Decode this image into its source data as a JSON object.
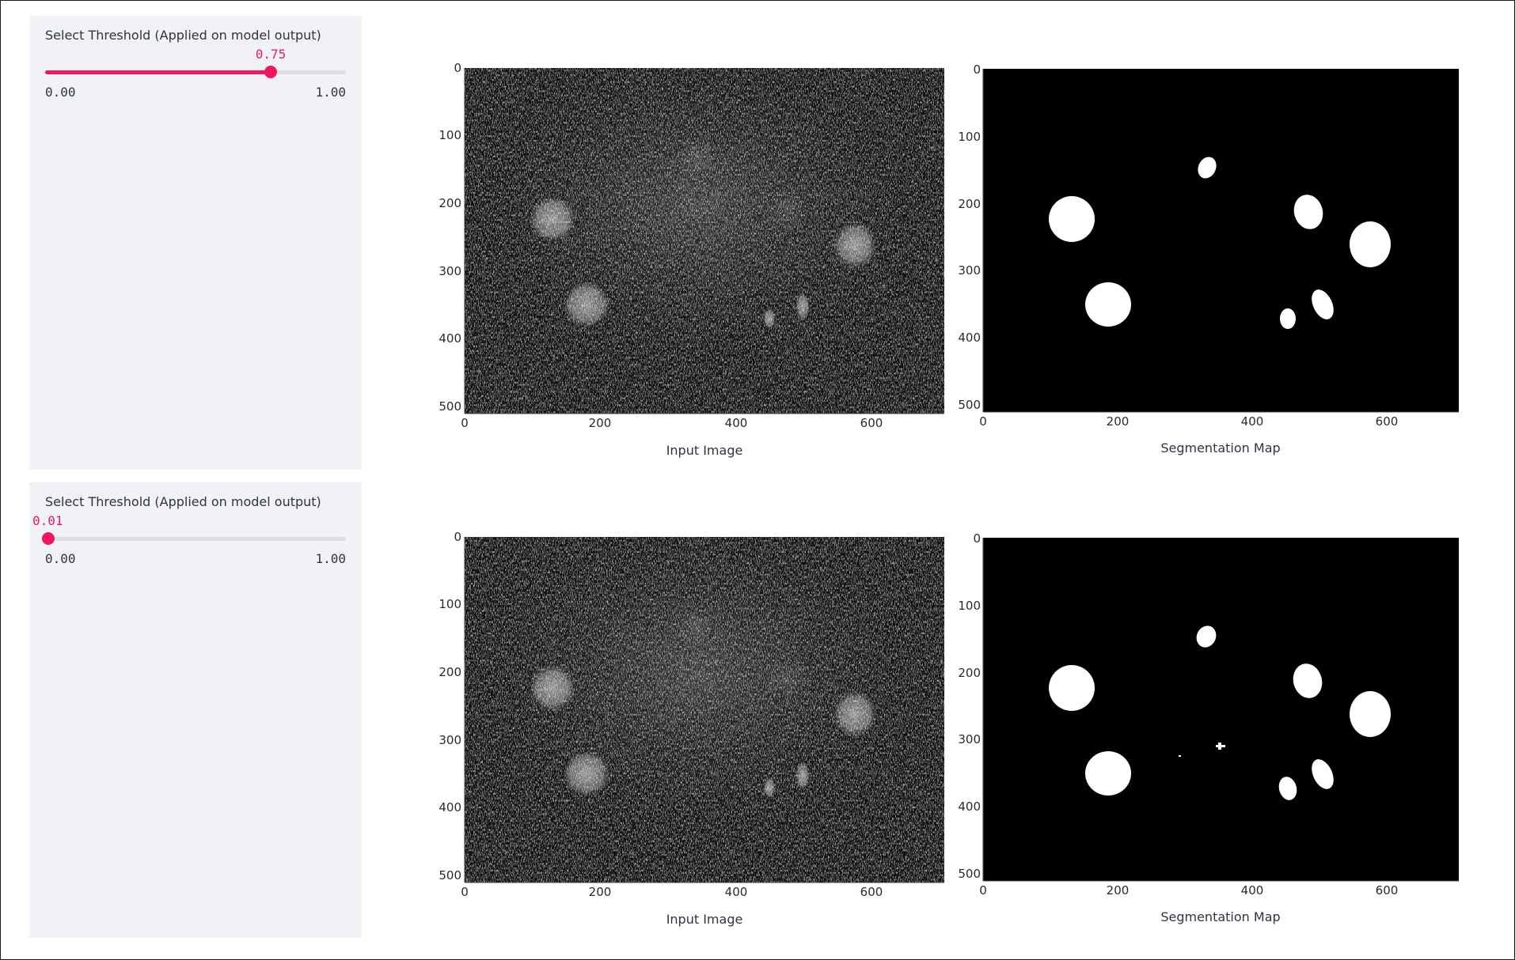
{
  "rows": [
    {
      "slider": {
        "label": "Select Threshold (Applied on model output)",
        "value": 0.75,
        "value_text": "0.75",
        "min_text": "0.00",
        "max_text": "1.00",
        "accent_color": "#f0175e"
      },
      "input_plot": {
        "caption": "Input Image",
        "x_ticks": [
          "0",
          "200",
          "400",
          "600"
        ],
        "y_ticks": [
          "0",
          "100",
          "200",
          "300",
          "400",
          "500"
        ]
      },
      "segmentation_plot": {
        "caption": "Segmentation Map",
        "x_ticks": [
          "0",
          "200",
          "400",
          "600"
        ],
        "y_ticks": [
          "0",
          "100",
          "200",
          "300",
          "400",
          "500"
        ]
      }
    },
    {
      "slider": {
        "label": "Select Threshold (Applied on model output)",
        "value": 0.01,
        "value_text": "0.01",
        "min_text": "0.00",
        "max_text": "1.00",
        "accent_color": "#f0175e"
      },
      "input_plot": {
        "caption": "Input Image",
        "x_ticks": [
          "0",
          "200",
          "400",
          "600"
        ],
        "y_ticks": [
          "0",
          "100",
          "200",
          "300",
          "400",
          "500"
        ]
      },
      "segmentation_plot": {
        "caption": "Segmentation Map",
        "x_ticks": [
          "0",
          "200",
          "400",
          "600"
        ],
        "y_ticks": [
          "0",
          "100",
          "200",
          "300",
          "400",
          "500"
        ]
      }
    }
  ]
}
